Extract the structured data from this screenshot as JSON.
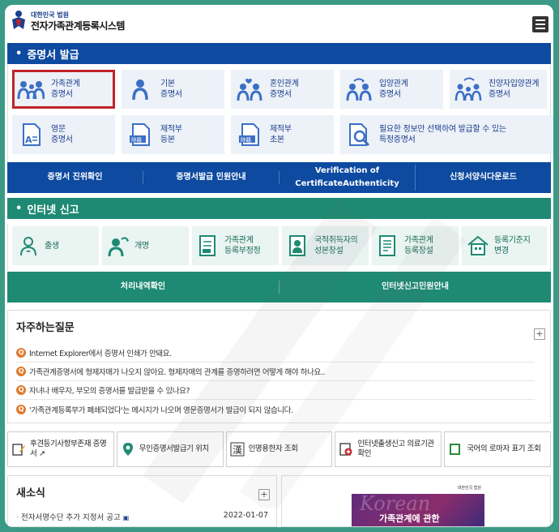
{
  "header": {
    "org": "대한민국 법원",
    "title": "전자가족관계등록시스템"
  },
  "cert_section": {
    "title": "증명서 발급",
    "cards": [
      {
        "label1": "가족관계",
        "label2": "증명서",
        "icon": "family-icon"
      },
      {
        "label1": "기본",
        "label2": "증명서",
        "icon": "person-icon"
      },
      {
        "label1": "혼인관계",
        "label2": "증명서",
        "icon": "couple-icon"
      },
      {
        "label1": "입양관계",
        "label2": "증명서",
        "icon": "adoption-icon"
      },
      {
        "label1": "친양자입양관계",
        "label2": "증명서",
        "icon": "adoption-family-icon"
      },
      {
        "label1": "영문",
        "label2": "증명서",
        "icon": "english-doc-icon"
      },
      {
        "label1": "제적부",
        "label2": "등본",
        "icon": "removed-doc-icon"
      },
      {
        "label1": "제적부",
        "label2": "초본",
        "icon": "removed-doc-icon"
      },
      {
        "label1": "필요한 정보만 선택하여 발급할 수 있는",
        "label2": "특정증명서",
        "icon": "search-doc-icon"
      }
    ],
    "links": [
      "증명서 진위확인",
      "증명서발급 민원안내",
      "Verification of CertificateAuthenticity",
      "신청서양식다운로드"
    ]
  },
  "net_section": {
    "title": "인터넷 신고",
    "cards": [
      {
        "label1": "출생",
        "label2": "",
        "icon": "birth-icon"
      },
      {
        "label1": "개명",
        "label2": "",
        "icon": "rename-icon"
      },
      {
        "label1": "가족관계",
        "label2": "등록부정정",
        "icon": "correction-doc-icon"
      },
      {
        "label1": "국적취득자의",
        "label2": "성본창설",
        "icon": "nationality-icon"
      },
      {
        "label1": "가족관계",
        "label2": "등록창설",
        "icon": "register-doc-icon"
      },
      {
        "label1": "등록기준지",
        "label2": "변경",
        "icon": "home-icon"
      }
    ],
    "links": [
      "처리내역확인",
      "인터넷신고민원안내"
    ]
  },
  "faq": {
    "title": "자주하는질문",
    "items": [
      "Internet Explorer에서 증명서 인쇄가 안돼요.",
      "가족관계증명서에 형제자매가 나오지 않아요. 형제자매의 관계를 증명하려면 어떻게 해야 하나요..",
      "자녀나 배우자, 부모의 증명서를 발급받을 수 있나요?",
      "'가족관계등록부가 폐쇄되었다'는 메시지가 나오며 영문증명서가 발급이 되지 않습니다."
    ]
  },
  "quick_links": [
    {
      "label": "후견등기사항부존재 증명서 ↗",
      "icon": "doc-pen-icon"
    },
    {
      "label": "무인증명서발급기 위치",
      "icon": "location-pin-icon"
    },
    {
      "label": "인명용한자 조회",
      "icon": "hanja-icon"
    },
    {
      "label": "인터넷출생신고 의료기관 확인",
      "icon": "hospital-doc-icon"
    },
    {
      "label": "국어의 로마자 표기 조회",
      "icon": "book-icon"
    }
  ],
  "news": {
    "title": "새소식",
    "item": "전자서명수단 추가 지정서 공고",
    "date": "2022-01-07"
  },
  "banner": {
    "script": "Korean",
    "text": "가족관계에 관한",
    "org": "대한민국 법원"
  },
  "colors": {
    "blue": "#0d4aa0",
    "green": "#1e8a73",
    "highlight": "#c0232a",
    "faq_icon": "#e07a2c"
  }
}
